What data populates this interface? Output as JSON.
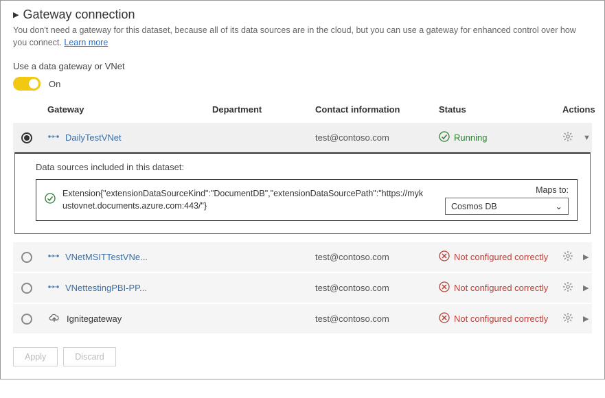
{
  "header": {
    "title": "Gateway connection",
    "description": "You don't need a gateway for this dataset, because all of its data sources are in the cloud, but you can use a gateway for enhanced control over how you connect.",
    "learn_more": "Learn more"
  },
  "toggle": {
    "section_label": "Use a data gateway or VNet",
    "state_label": "On",
    "on": true
  },
  "columns": {
    "gateway": "Gateway",
    "department": "Department",
    "contact": "Contact information",
    "status": "Status",
    "actions": "Actions"
  },
  "gateways": [
    {
      "selected": true,
      "type": "vnet",
      "name": "DailyTestVNet",
      "department": "",
      "contact": "test@contoso.com",
      "status_text": "Running",
      "status_kind": "running",
      "expanded": true
    },
    {
      "selected": false,
      "type": "vnet",
      "name": "VNetMSITTestVNe...",
      "department": "",
      "contact": "test@contoso.com",
      "status_text": "Not configured correctly",
      "status_kind": "error",
      "expanded": false
    },
    {
      "selected": false,
      "type": "vnet",
      "name": "VNettestingPBI-PP...",
      "department": "",
      "contact": "test@contoso.com",
      "status_text": "Not configured correctly",
      "status_kind": "error",
      "expanded": false
    },
    {
      "selected": false,
      "type": "cloud",
      "name": "Ignitegateway",
      "department": "",
      "contact": "test@contoso.com",
      "status_text": "Not configured correctly",
      "status_kind": "error",
      "expanded": false
    }
  ],
  "datasource_panel": {
    "header": "Data sources included in this dataset:",
    "text": "Extension{\"extensionDataSourceKind\":\"DocumentDB\",\"extensionDataSourcePath\":\"https://mykustovnet.documents.azure.com:443/\"}",
    "maps_to_label": "Maps to:",
    "selected_option": "Cosmos DB"
  },
  "buttons": {
    "apply": "Apply",
    "discard": "Discard"
  }
}
